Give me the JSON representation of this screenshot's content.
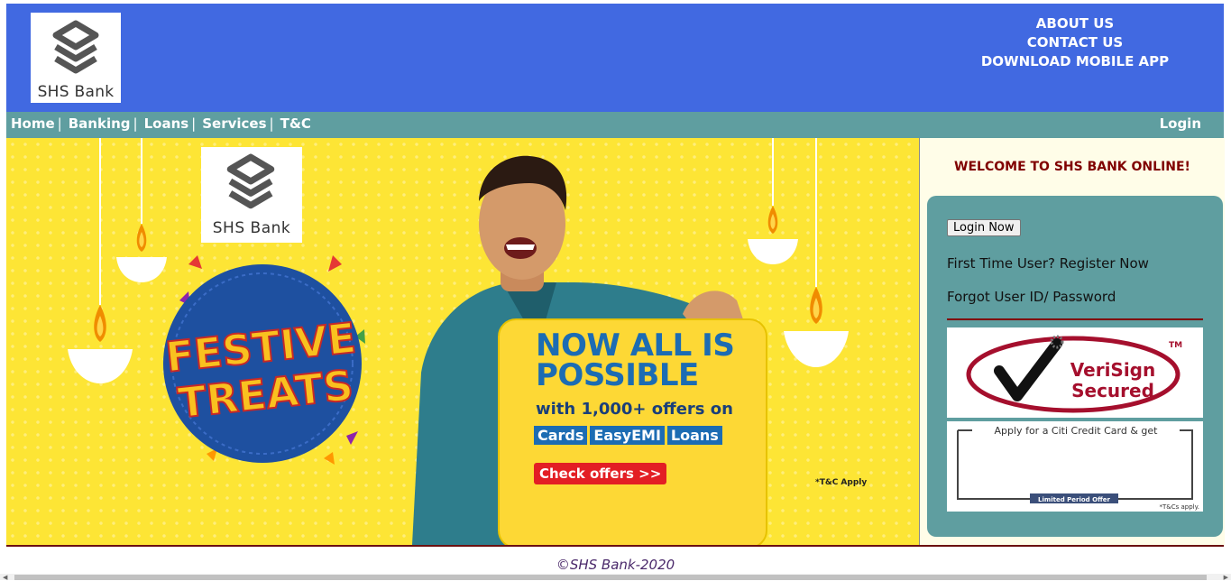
{
  "header": {
    "logo_text": "SHS Bank",
    "links": [
      "ABOUT US",
      "CONTACT US",
      "DOWNLOAD MOBILE APP"
    ]
  },
  "nav": {
    "items": [
      "Home",
      "Banking",
      "Loans",
      "Services",
      "T&C"
    ],
    "separator": "|",
    "login": "Login"
  },
  "banner": {
    "logo_text": "SHS Bank",
    "badge_line1": "FESTIVE",
    "badge_line2": "TREATS",
    "offer_title_line1": "NOW ALL IS",
    "offer_title_line2": "POSSIBLE",
    "offer_sub": "with 1,000+ offers on",
    "chips": [
      "Cards",
      "EasyEMI",
      "Loans"
    ],
    "cta": "Check offers >>",
    "tc": "*T&C Apply"
  },
  "sidebar": {
    "welcome": "WELCOME TO SHS BANK ONLINE!",
    "login_button": "Login Now",
    "register_link": "First Time User? Register Now",
    "forgot_link": "Forgot User ID/ Password",
    "verisign_line1": "VeriSign",
    "verisign_line2": "Secured",
    "verisign_tm": "TM",
    "citi_text": "Apply for a Citi Credit Card & get",
    "citi_badge": "Limited Period Offer",
    "citi_tc": "*T&Cs apply."
  },
  "footer": {
    "copyright": "©SHS Bank-2020"
  },
  "colors": {
    "header_bg": "#4169e1",
    "nav_bg": "#5f9ea0",
    "banner_bg": "#fde535",
    "accent_maroon": "#800000"
  }
}
